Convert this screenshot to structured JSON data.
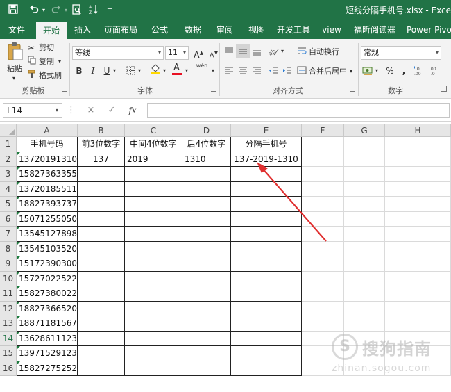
{
  "window": {
    "title": "短线分隔手机号.xlsx - Exce",
    "quick_access": {
      "save_icon": "floppy-save-icon",
      "undo_icon": "undo-icon",
      "redo_icon": "redo-icon",
      "print_preview_icon": "print-preview-icon",
      "sort_icon": "sort-ascending-icon",
      "customize_icon": "customize-toolbar-icon"
    }
  },
  "tabs": [
    "文件",
    "开始",
    "插入",
    "页面布局",
    "公式",
    "数据",
    "审阅",
    "视图",
    "开发工具",
    "view",
    "福昕阅读器",
    "Power Pivot"
  ],
  "active_tab": "开始",
  "ribbon": {
    "clipboard": {
      "paste": "粘贴",
      "cut": "剪切",
      "copy": "复制",
      "format_painter": "格式刷",
      "label": "剪贴板"
    },
    "font": {
      "font_name": "等线",
      "font_size": "11",
      "grow": "A",
      "shrink": "A",
      "bold": "B",
      "italic": "I",
      "underline": "U",
      "wen": "wén",
      "font_color_letter": "A",
      "label": "字体",
      "accent_yellow": "#ffd800",
      "accent_red": "#e81123"
    },
    "alignment": {
      "wrap_text": "自动换行",
      "merge_center": "合并后居中",
      "label": "对齐方式"
    },
    "number": {
      "format": "常规",
      "percent": "%",
      "comma": ",",
      "label": "数字"
    }
  },
  "formula_bar": {
    "name_box": "L14",
    "cancel_icon": "×",
    "enter_icon": "✓",
    "fx": "fx",
    "formula": ""
  },
  "sheet": {
    "columns": [
      "A",
      "B",
      "C",
      "D",
      "E",
      "F",
      "G",
      "H"
    ],
    "row_numbers": [
      "1",
      "2",
      "3",
      "4",
      "5",
      "6",
      "7",
      "8",
      "9",
      "10",
      "11",
      "12",
      "13",
      "14",
      "15",
      "16"
    ],
    "active_row": "14",
    "headers": [
      "手机号码",
      "前3位数字",
      "中间4位数字",
      "后4位数字",
      "分隔手机号"
    ],
    "row2": {
      "b": "137",
      "c": "2019",
      "d": "1310",
      "e": "137-2019-1310"
    },
    "phones": [
      "13720191310",
      "15827363355",
      "13720185511",
      "18827393737",
      "15071255050",
      "13545127898",
      "13545103520",
      "15172390300",
      "15727022522",
      "15827380022",
      "18827366520",
      "18871181567",
      "13628611123",
      "13971529123",
      "15827275252"
    ],
    "arrow_color": "#e03030"
  },
  "watermark": {
    "text": "搜狗指南",
    "url": "zhinan.sogou.com",
    "logo": "S"
  }
}
